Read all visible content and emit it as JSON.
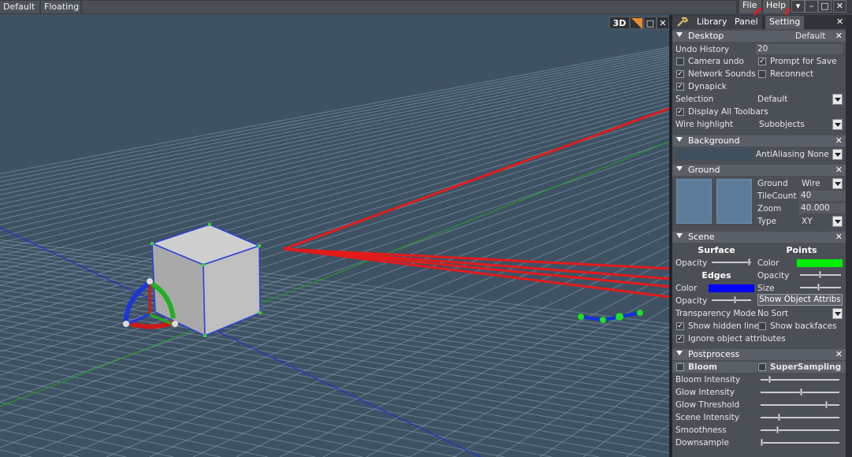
{
  "topbar": {
    "tabs": [
      "Default",
      "Floating"
    ],
    "menu": [
      "File",
      "Help"
    ],
    "window_buttons": [
      "▾",
      "–",
      "□",
      "✕"
    ]
  },
  "viewport": {
    "mode": "3D",
    "buttons": [
      "□",
      "✕"
    ]
  },
  "panel": {
    "tabs": [
      "Library",
      "Panel",
      "Setting"
    ],
    "desktop": {
      "title": "Desktop",
      "preset": "Default",
      "undo_label": "Undo History",
      "undo_value": "20",
      "camera_undo": "Camera undo",
      "prompt_save": "Prompt for Save",
      "network_sounds": "Network Sounds",
      "reconnect": "Reconnect",
      "dynapick": "Dynapick",
      "selection_label": "Selection",
      "selection_value": "Default",
      "display_toolbars": "Display All Toolbars",
      "wire_label": "Wire highlight",
      "wire_value": "Subobjects"
    },
    "background": {
      "title": "Background",
      "aa": "AntiAliasing None"
    },
    "ground": {
      "title": "Ground",
      "ground_label": "Ground",
      "ground_value": "Wire",
      "tile_label": "TileCount",
      "tile_value": "40",
      "zoom_label": "Zoom",
      "zoom_value": "40.000",
      "type_label": "Type",
      "type_value": "XY"
    },
    "scene": {
      "title": "Scene",
      "surface": "Surface",
      "points": "Points",
      "opacity": "Opacity",
      "color": "Color",
      "edges": "Edges",
      "size": "Size",
      "show_attribs": "Show Object Attribs",
      "transp_label": "Transparency Mode",
      "transp_value": "No Sort",
      "show_hidden": "Show hidden lines",
      "show_backfaces": "Show backfaces",
      "ignore_attr": "Ignore object attributes"
    },
    "postprocess": {
      "title": "Postprocess",
      "bloom": "Bloom",
      "supersampling": "SuperSampling",
      "rows": [
        "Bloom Intensity",
        "Glow Intensity",
        "Glow Threshold",
        "Scene Intensity",
        "Smoothness",
        "Downsample"
      ]
    }
  },
  "colors": {
    "points_color": "#00ee00",
    "edges_color": "#0000ff",
    "accent": "#e21b1b"
  }
}
